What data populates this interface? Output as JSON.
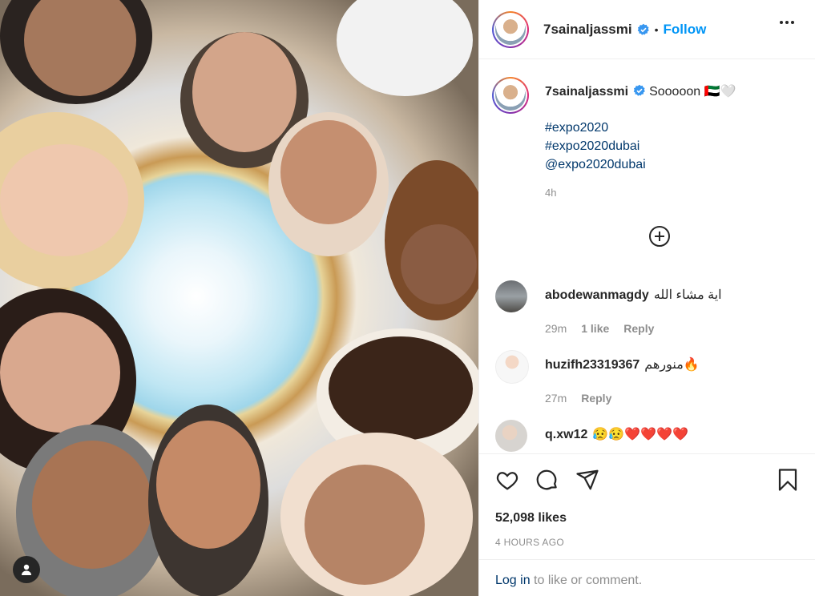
{
  "post": {
    "username": "7sainaljassmi",
    "follow_label": "Follow",
    "separator": "•"
  },
  "caption": {
    "username": "7sainaljassmi",
    "text": "Sooooon 🇦🇪🤍",
    "hashtags": [
      "#expo2020",
      "#expo2020dubai",
      "@expo2020dubai"
    ],
    "time": "4h"
  },
  "comments": [
    {
      "username": "abodewanmagdy",
      "text": "اية مشاء الله",
      "time": "29m",
      "likes": "1 like",
      "reply": "Reply"
    },
    {
      "username": "huzifh23319367",
      "text": "منورهم🔥",
      "time": "27m",
      "likes": "",
      "reply": "Reply"
    },
    {
      "username": "q.xw12",
      "text": "😥😥❤️❤️❤️❤️",
      "time": "",
      "likes": "",
      "reply": ""
    }
  ],
  "stats": {
    "likes": "52,098 likes",
    "posted": "4 HOURS AGO"
  },
  "footer": {
    "login_link": "Log in",
    "login_rest": " to like or comment."
  },
  "icons": {
    "verified": "verified-badge-icon",
    "like": "heart-icon",
    "comment": "comment-icon",
    "share": "paper-plane-icon",
    "save": "bookmark-icon",
    "more": "more-options-icon",
    "load_more": "plus-circle-icon",
    "user": "user-silhouette-icon"
  },
  "colors": {
    "link_blue": "#0095f6",
    "hashtag_blue": "#00376b",
    "muted_gray": "#8e8e8e",
    "text": "#262626"
  }
}
